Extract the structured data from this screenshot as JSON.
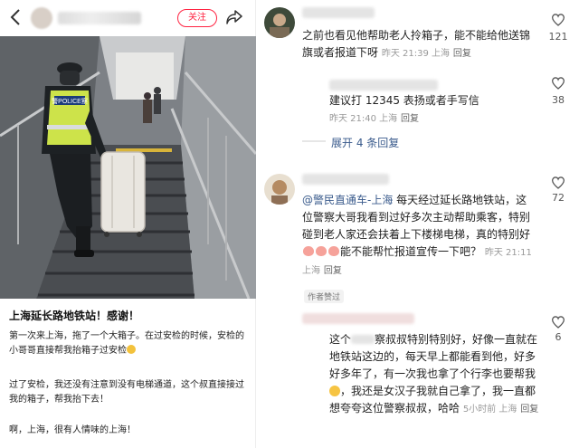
{
  "post": {
    "follow_label": "关注",
    "title": "上海延长路地铁站！感谢！",
    "para1": "第一次来上海，拖了一个大箱子。在过安检的时候，安检的小哥哥直接帮我抬箱子过安检",
    "para2": "过了安检，我还没有注意到没有电梯通道，这个叔直接接过我的箱子，帮我抬下去！",
    "para3": "啊，上海，很有人情味的上海！",
    "photo": {
      "vest_label": "警POLICE察"
    }
  },
  "comments": [
    {
      "text": "之前也看见他帮助老人拎箱子，能不能给他送锦旗或者报道下呀",
      "time": "昨天 21:39 上海",
      "reply": "回复",
      "likes": "121"
    },
    {
      "text": "建议打 12345 表扬或者手写信",
      "time": "昨天 21:40 上海",
      "reply": "回复",
      "likes": "38",
      "expand": "展开 4 条回复"
    },
    {
      "mention": "@警民直通车-上海",
      "text_a": " 每天经过延长路地铁站，这位警察大哥我看到过好多次主动帮助乘客，特别碰到老人家还会扶着上下楼梯电梯，真的特别好",
      "text_b": "能不能帮忙报道宣传一下吧？",
      "time": "昨天 21:11 上海",
      "reply": "回复",
      "likes": "72",
      "badge": "作者赞过"
    },
    {
      "text_a": "这个",
      "text_b": "察叔叔特别特别好，好像一直就在地铁站这边的，每天早上都能看到他，好多好多年了，有一次我也拿了个行李也要帮我",
      "text_c": "，我还是女汉子我就自己拿了，我一直都想夸夸这位警察叔叔，哈哈",
      "time": "5小时前 上海",
      "reply": "回复",
      "likes": "6"
    }
  ],
  "colors": {
    "accent": "#ff2442",
    "link": "#3a5b8c",
    "meta": "#999999"
  },
  "icons": [
    "back-arrow-icon",
    "share-icon",
    "heart-icon"
  ]
}
